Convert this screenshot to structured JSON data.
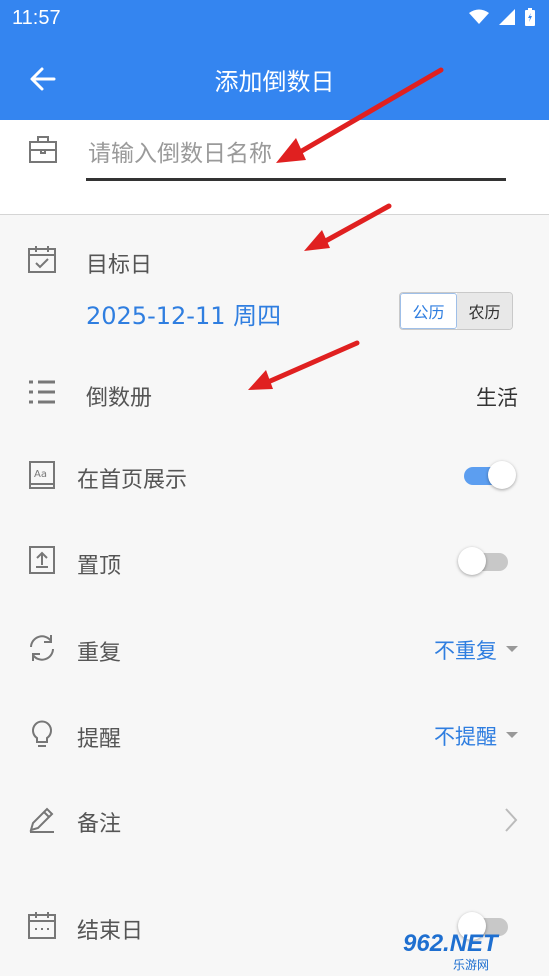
{
  "status": {
    "time": "11:57"
  },
  "appbar": {
    "title": "添加倒数日"
  },
  "name": {
    "placeholder": "请输入倒数日名称"
  },
  "target": {
    "label": "目标日",
    "date": "2025-12-11 周四",
    "calendar_solar": "公历",
    "calendar_lunar": "农历"
  },
  "book": {
    "label": "倒数册",
    "value": "生活"
  },
  "homepage": {
    "label": "在首页展示",
    "enabled": true
  },
  "pin": {
    "label": "置顶",
    "enabled": false
  },
  "repeat": {
    "label": "重复",
    "value": "不重复"
  },
  "remind": {
    "label": "提醒",
    "value": "不提醒"
  },
  "note": {
    "label": "备注"
  },
  "end": {
    "label": "结束日",
    "enabled": false
  },
  "watermark": {
    "text": "962.NET",
    "subtext": "乐游网"
  },
  "colors": {
    "primary": "#3485f0",
    "accent": "#2f7ee0",
    "arrow": "#e02020"
  }
}
